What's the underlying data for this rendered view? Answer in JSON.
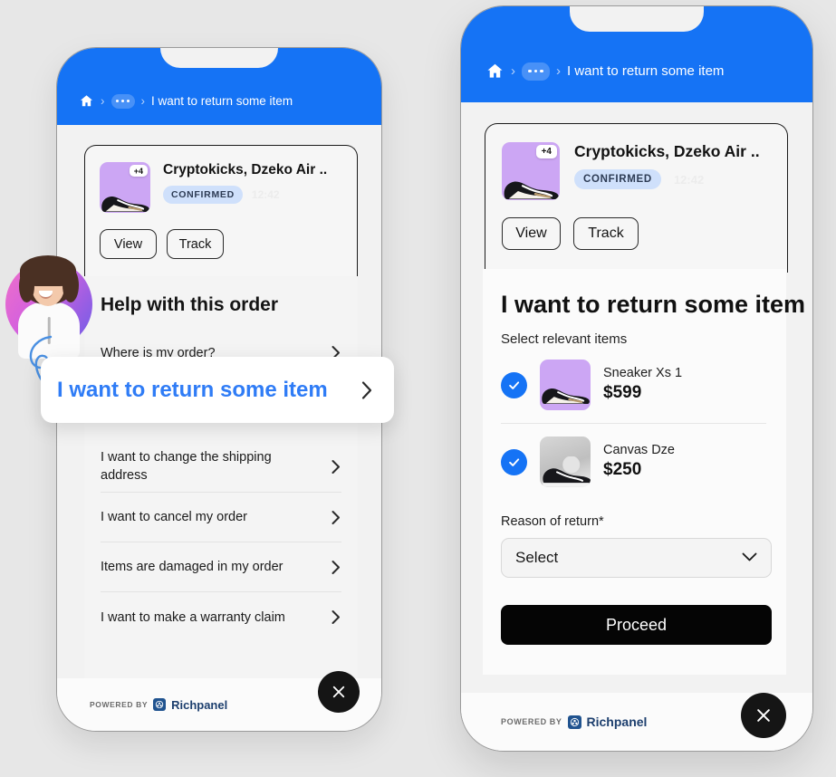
{
  "theme": {
    "background": "#e7e7e7",
    "brand_blue": "#1573f5",
    "link_blue": "#2f7cf6",
    "thumb_purple": "#cca6f4",
    "pill_blue": "#cfe0fb",
    "black": "#050505"
  },
  "left_phone": {
    "breadcrumb": {
      "home_icon": "home-icon",
      "separator": "›",
      "dots_icon": "ellipsis-icon",
      "title": "I want to return some item"
    },
    "order_card": {
      "thumbnail_badge": "+4",
      "thumbnail_icon": "sneaker-thumbnail",
      "title": "Cryptokicks, Dzeko Air ..",
      "status": "CONFIRMED",
      "ghost_time": "12:42",
      "view_label": "View",
      "track_label": "Track"
    },
    "help": {
      "heading": "Help with this order",
      "items": [
        {
          "label": "Where is my order?",
          "highlighted": false
        },
        {
          "label": "I want to change the shipping address",
          "highlighted": false
        },
        {
          "label": "I want to cancel my order",
          "highlighted": false
        },
        {
          "label": "Items are damaged in my order",
          "highlighted": false
        },
        {
          "label": "I want to make a warranty claim",
          "highlighted": false
        }
      ]
    },
    "highlight_card": {
      "label": "I want to return some item",
      "chevron_icon": "chevron-right-icon"
    },
    "footer": {
      "powered_by": "POWERED BY",
      "brand": "Richpanel",
      "close_icon": "close-icon"
    }
  },
  "right_phone": {
    "breadcrumb": {
      "home_icon": "home-icon",
      "separator": "›",
      "dots_icon": "ellipsis-icon",
      "title": "I want to return some item"
    },
    "order_card": {
      "thumbnail_badge": "+4",
      "thumbnail_icon": "sneaker-thumbnail",
      "title": "Cryptokicks, Dzeko Air ..",
      "status": "CONFIRMED",
      "ghost_time": "12:42",
      "view_label": "View",
      "track_label": "Track"
    },
    "return_form": {
      "title": "I want to return some item",
      "subtitle": "Select relevant items",
      "items": [
        {
          "name": "Sneaker Xs 1",
          "price": "$599",
          "checked": true,
          "thumb": "purple"
        },
        {
          "name": "Canvas Dze",
          "price": "$250",
          "checked": true,
          "thumb": "gray"
        }
      ],
      "reason_label": "Reason of return*",
      "reason_value": "Select",
      "reason_chevron_icon": "chevron-down-icon",
      "submit_label": "Proceed"
    },
    "footer": {
      "powered_by": "POWERED BY",
      "brand": "Richpanel",
      "close_icon": "close-icon"
    }
  }
}
